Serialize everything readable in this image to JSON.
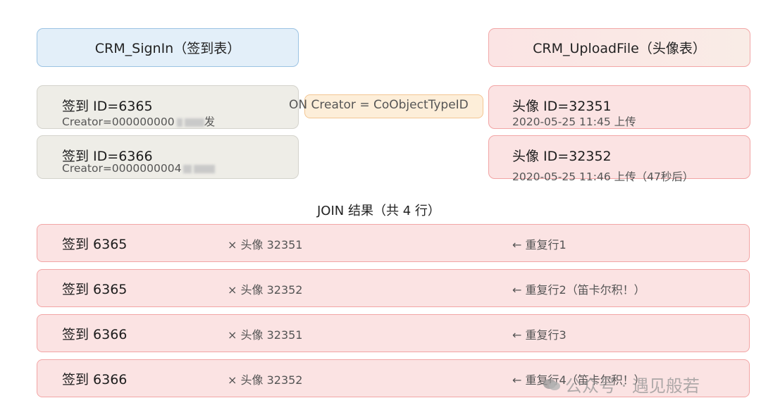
{
  "left_table": {
    "header": "CRM_SignIn（签到表）",
    "records": [
      {
        "id": "签到 ID=6365",
        "creator": "Creator=000000000",
        "suffix": "发"
      },
      {
        "id": "签到 ID=6366",
        "creator": "Creator=0000000004",
        "suffix": ""
      }
    ]
  },
  "right_table": {
    "header": "CRM_UploadFile（头像表）",
    "records": [
      {
        "id": "头像 ID=32351",
        "time": "2020-05-25 11:45 上传"
      },
      {
        "id": "头像 ID=32352",
        "time": "2020-05-25 11:46 上传（47秒后）"
      }
    ]
  },
  "join_condition": "ON Creator = CoObjectTypeID",
  "result": {
    "title": "JOIN 结果（共 4 行）",
    "rows": [
      {
        "signin": "签到 6365",
        "avatar": "× 头像 32351",
        "note": "← 重复行1"
      },
      {
        "signin": "签到 6365",
        "avatar": "× 头像 32352",
        "note": "← 重复行2（笛卡尔积！）"
      },
      {
        "signin": "签到 6366",
        "avatar": "× 头像 32351",
        "note": "← 重复行3"
      },
      {
        "signin": "签到 6366",
        "avatar": "× 头像 32352",
        "note": "← 重复行4（笛卡尔积！）"
      }
    ]
  },
  "watermark": "公众号 · 遇见般若",
  "colors": {
    "header_blue": "#e3eff9",
    "header_pink": "#fbe4e4",
    "record_grey": "#eeede7",
    "record_pink": "#fbe3e3",
    "join_label": "#fdeed9"
  }
}
